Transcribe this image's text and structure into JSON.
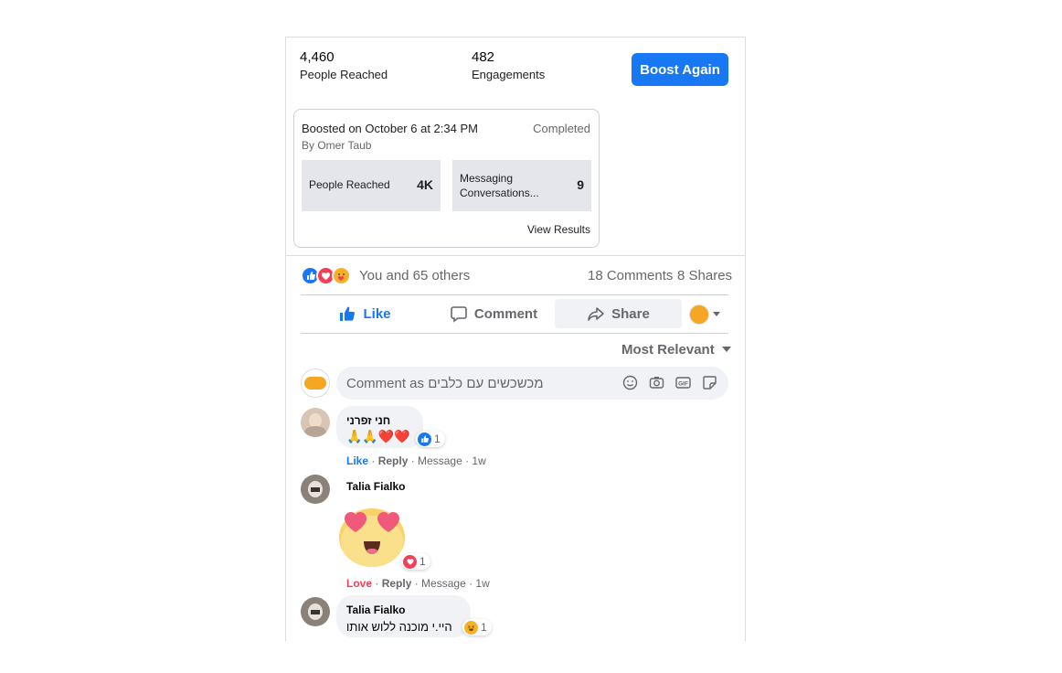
{
  "stats": {
    "people_reached_value": "4,460",
    "people_reached_label": "People Reached",
    "engagements_value": "482",
    "engagements_label": "Engagements"
  },
  "boost_button_label": "Boost Again",
  "boost_summary": {
    "boosted_on": "Boosted on October 6 at 2:34 PM",
    "status": "Completed",
    "by": "By Omer Taub",
    "tile1_label": "People Reached",
    "tile1_value": "4K",
    "tile2_label_line1": "Messaging",
    "tile2_label_line2": "Conversations...",
    "tile2_value": "9",
    "view_results": "View Results"
  },
  "reactions_summary": {
    "text": "You and 65 others",
    "comments": "18 Comments",
    "shares": "8 Shares",
    "icons": [
      "like-icon",
      "love-icon",
      "care-icon"
    ]
  },
  "actions": {
    "like": "Like",
    "comment": "Comment",
    "share": "Share"
  },
  "sort_label": "Most Relevant",
  "comment_input": {
    "placeholder": "Comment as מכשכשים עם כלבים",
    "icons": [
      "emoji-icon",
      "camera-icon",
      "gif-icon",
      "sticker-icon"
    ]
  },
  "comments": [
    {
      "author": "חני זפרני",
      "text": "🙏🙏❤️❤️",
      "reaction_count": "1",
      "reaction_type": "like",
      "my_reaction": "Like",
      "reply": "Reply",
      "message": "Message",
      "time": "1w"
    },
    {
      "author": "Talia Fialko",
      "sticker": "😍",
      "reaction_count": "1",
      "reaction_type": "love",
      "my_reaction": "Love",
      "reply": "Reply",
      "message": "Message",
      "time": "1w"
    },
    {
      "author": "Talia Fialko",
      "text": "היי.י מוכנה ללוש אותו",
      "reaction_count": "1",
      "reaction_type": "haha"
    }
  ],
  "colors": {
    "brand_blue": "#1877f2",
    "love_red": "#f33e58",
    "muted": "#65676b",
    "bubble_bg": "#f0f2f5"
  }
}
